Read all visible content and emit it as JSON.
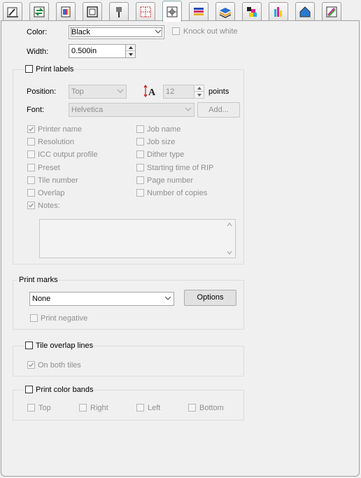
{
  "colors": {
    "panel_bg": "#f0f0f0",
    "disabled_text": "#8f8f8f",
    "group_border": "#dcdcdc"
  },
  "toolbar": {
    "tabs": [
      {
        "icon": "layout-ruler-icon"
      },
      {
        "icon": "arrows-transfer-icon"
      },
      {
        "icon": "color-image-icon"
      },
      {
        "icon": "page-frame-icon"
      },
      {
        "icon": "pushpin-icon"
      },
      {
        "icon": "grid-dots-icon"
      },
      {
        "icon": "marks-target-icon"
      },
      {
        "icon": "color-stack-icon"
      },
      {
        "icon": "layers-icon"
      },
      {
        "icon": "cmyk-blocks-icon"
      },
      {
        "icon": "color-bars-icon"
      },
      {
        "icon": "house-shape-icon"
      },
      {
        "icon": "color-picker-icon"
      }
    ],
    "active_index": 6
  },
  "line": {
    "color_label": "Color:",
    "color_value": "Black",
    "knockout_label": "Knock out white",
    "width_label": "Width:",
    "width_value": "0.500in"
  },
  "labels": {
    "print_labels": "Print labels",
    "position_label": "Position:",
    "position_value": "Top",
    "size_value": "12",
    "points_label": "points",
    "font_label": "Font:",
    "font_value": "Helvetica",
    "add_button": "Add...",
    "options_left": [
      {
        "label": "Printer name",
        "checked": true
      },
      {
        "label": "Resolution",
        "checked": false
      },
      {
        "label": "ICC output profile",
        "checked": false
      },
      {
        "label": "Preset",
        "checked": false
      },
      {
        "label": "Tile number",
        "checked": false
      },
      {
        "label": "Overlap",
        "checked": false
      },
      {
        "label": "Notes:",
        "checked": true
      }
    ],
    "options_right": [
      {
        "label": "Job name",
        "checked": false
      },
      {
        "label": "Job size",
        "checked": false
      },
      {
        "label": "Dither type",
        "checked": false
      },
      {
        "label": "Starting time of RIP",
        "checked": false
      },
      {
        "label": "Page number",
        "checked": false
      },
      {
        "label": "Number of copies",
        "checked": false
      }
    ],
    "notes_text": ""
  },
  "marks": {
    "title": "Print marks",
    "value": "None",
    "options_button": "Options",
    "print_negative": "Print negative"
  },
  "tile": {
    "title": "Tile overlap lines",
    "both_tiles": "On both tiles"
  },
  "bands": {
    "title": "Print color bands",
    "sides": [
      "Top",
      "Right",
      "Left",
      "Bottom"
    ]
  }
}
